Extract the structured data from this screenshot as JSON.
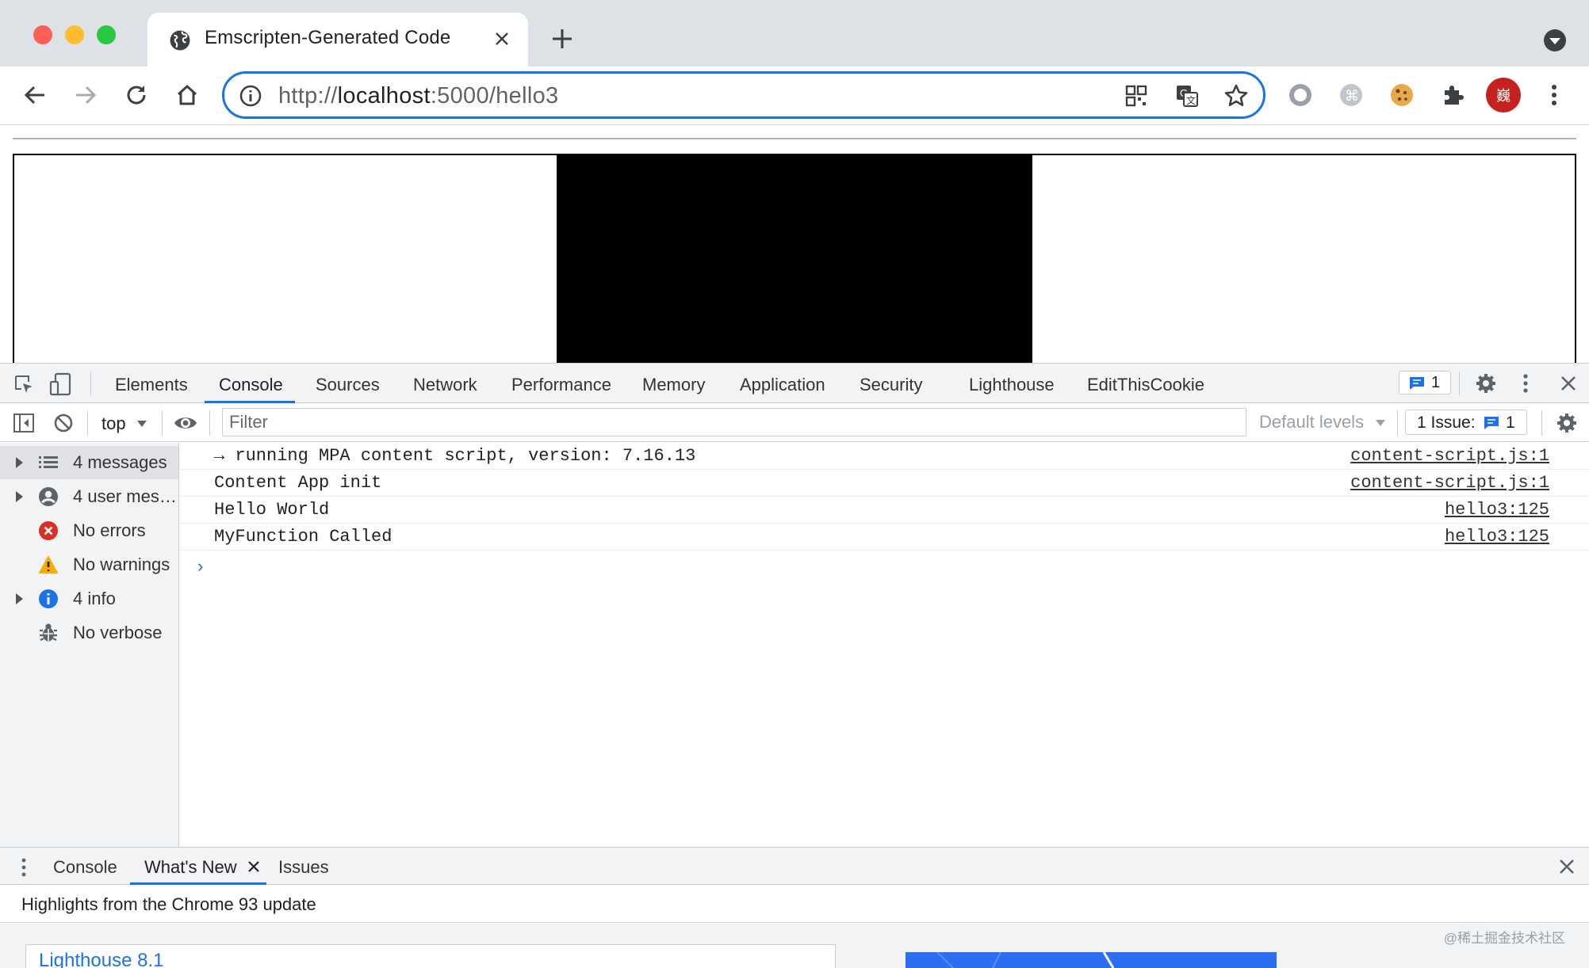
{
  "browser": {
    "tab_title": "Emscripten-Generated Code",
    "url_scheme": "http://",
    "url_host": "localhost",
    "url_rest": ":5000/hello3",
    "profile_avatar_text": "巍"
  },
  "devtools": {
    "tabs": [
      "Elements",
      "Console",
      "Sources",
      "Network",
      "Performance",
      "Memory",
      "Application",
      "Security",
      "Lighthouse",
      "EditThisCookie"
    ],
    "issues_badge_count": "1",
    "context_selector": "top",
    "filter_placeholder": "Filter",
    "default_levels": "Default levels",
    "issues_label": "1 Issue:",
    "issues_count": "1",
    "sidebar": [
      {
        "label": "4 messages",
        "icon": "list-icon",
        "expandable": true
      },
      {
        "label": "4 user mes…",
        "icon": "user-icon",
        "expandable": true
      },
      {
        "label": "No errors",
        "icon": "error-icon",
        "expandable": false
      },
      {
        "label": "No warnings",
        "icon": "warning-icon",
        "expandable": false
      },
      {
        "label": "4 info",
        "icon": "info-icon",
        "expandable": true
      },
      {
        "label": "No verbose",
        "icon": "bug-icon",
        "expandable": false
      }
    ],
    "messages": [
      {
        "text": "→ running MPA content script, version: 7.16.13",
        "source": "content-script.js:1"
      },
      {
        "text": "Content App init",
        "source": "content-script.js:1"
      },
      {
        "text": "Hello World",
        "source": "hello3:125"
      },
      {
        "text": "MyFunction Called",
        "source": "hello3:125"
      }
    ],
    "prompt": "›"
  },
  "drawer": {
    "tabs": [
      "Console",
      "What's New",
      "Issues"
    ],
    "highlights": "Highlights from the Chrome 93 update",
    "card_title": "Lighthouse 8.1"
  },
  "watermark": "@稀土掘金技术社区",
  "colors": {
    "accent": "#1a73e8",
    "tabstrip": "#dee1e6",
    "panel_bg": "#f1f3f4",
    "error": "#d93025",
    "warning": "#f9ab00",
    "info": "#1a73e8",
    "avatar": "#c5221f"
  }
}
